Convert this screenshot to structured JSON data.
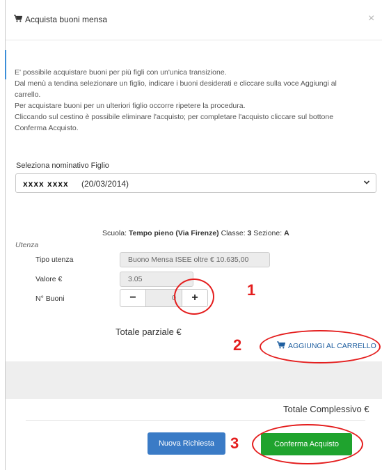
{
  "dialog": {
    "title": "Acquista buoni mensa",
    "close_label": "×"
  },
  "intro": {
    "line1": "E' possibile acquistare buoni per più figli con un'unica transizione.",
    "line2": "Dal menù a tendina selezionare un figlio, indicare i buoni desiderati e cliccare sulla voce Aggiungi al carrello.",
    "line3": "Per acquistare buoni per un ulteriori figlio occorre ripetere la procedura.",
    "line4": "Cliccando sul cestino è possibile eliminare l'acquisto; per completare l'acquisto cliccare sul bottone Conferma Acquisto."
  },
  "child_select": {
    "label": "Seleziona nominativo Figlio",
    "masked_name": "xxxx xxxx",
    "birthdate": "(20/03/2014)"
  },
  "school": {
    "scuola_label": "Scuola:",
    "scuola_value": "Tempo pieno (Via Firenze)",
    "classe_label": "Classe:",
    "classe_value": "3",
    "sezione_label": "Sezione:",
    "sezione_value": "A"
  },
  "utenza": {
    "section_label": "Utenza",
    "tipo_label": "Tipo utenza",
    "tipo_value": "Buono Mensa ISEE oltre € 10.635,00",
    "valore_label": "Valore €",
    "valore_value": "3.05",
    "buoni_label": "N° Buoni",
    "buoni_value": "0",
    "minus_label": "−",
    "plus_label": "+"
  },
  "totals": {
    "parziale_label": "Totale parziale €",
    "add_to_cart_label": "AGGIUNGI AL CARRELLO",
    "complessivo_label": "Totale Complessivo €"
  },
  "buttons": {
    "nuova_richiesta": "Nuova Richiesta",
    "conferma_acquisto": "Conferma Acquisto"
  },
  "annotations": {
    "step1": "1",
    "step2": "2",
    "step3": "3"
  },
  "colors": {
    "primary_blue": "#3a7bc6",
    "confirm_green": "#1fa32e",
    "annotation_red": "#e41d1d",
    "link_blue": "#1f5fa0"
  }
}
